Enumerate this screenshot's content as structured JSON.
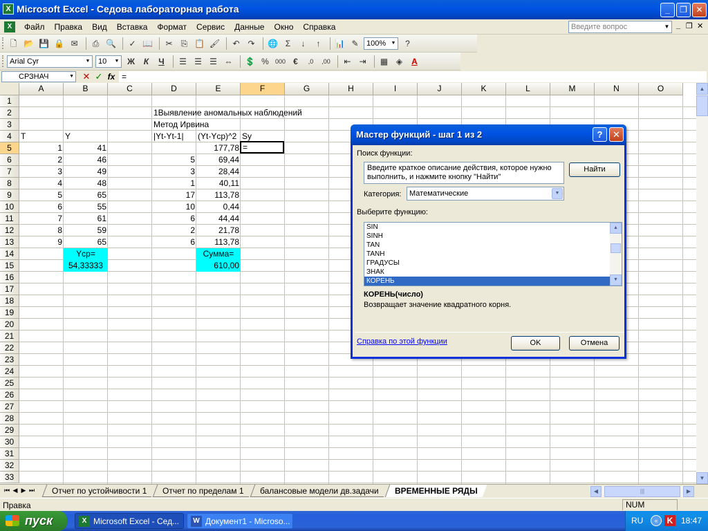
{
  "window": {
    "title": "Microsoft Excel - Седова лабораторная работа"
  },
  "menu": {
    "items": [
      "Файл",
      "Правка",
      "Вид",
      "Вставка",
      "Формат",
      "Сервис",
      "Данные",
      "Окно",
      "Справка"
    ],
    "ask_placeholder": "Введите вопрос"
  },
  "toolbar": {
    "zoom": "100%",
    "font": "Arial Cyr",
    "font_size": "10"
  },
  "formula_bar": {
    "name_box": "СРЗНАЧ",
    "formula": "="
  },
  "sheet": {
    "columns": [
      "A",
      "B",
      "C",
      "D",
      "E",
      "F",
      "G",
      "H",
      "I",
      "J",
      "K",
      "L",
      "M",
      "N",
      "O"
    ],
    "rows": [
      "1",
      "2",
      "3",
      "4",
      "5",
      "6",
      "7",
      "8",
      "9",
      "10",
      "11",
      "12",
      "13",
      "14",
      "15",
      "16",
      "17",
      "18",
      "19",
      "20",
      "21",
      "22",
      "23",
      "24",
      "25",
      "26",
      "27",
      "28",
      "29",
      "30",
      "31",
      "32",
      "33"
    ],
    "heading": "1Выявление аномальных наблюдений",
    "method": "Метод Ирвина",
    "headers": {
      "A": "T",
      "B": "Y",
      "D": "|Yt-Yt-1|",
      "E": "(Yt-Ycp)^2",
      "F": "Sy"
    },
    "data": [
      {
        "t": "1",
        "y": "41",
        "d": "",
        "e": "177,78"
      },
      {
        "t": "2",
        "y": "46",
        "d": "5",
        "e": "69,44"
      },
      {
        "t": "3",
        "y": "49",
        "d": "3",
        "e": "28,44"
      },
      {
        "t": "4",
        "y": "48",
        "d": "1",
        "e": "40,11"
      },
      {
        "t": "5",
        "y": "65",
        "d": "17",
        "e": "113,78"
      },
      {
        "t": "6",
        "y": "55",
        "d": "10",
        "e": "0,44"
      },
      {
        "t": "7",
        "y": "61",
        "d": "6",
        "e": "44,44"
      },
      {
        "t": "8",
        "y": "59",
        "d": "2",
        "e": "21,78"
      },
      {
        "t": "9",
        "y": "65",
        "d": "6",
        "e": "113,78"
      }
    ],
    "ycp_label": "Ycp=",
    "ycp_value": "54,33333",
    "sum_label": "Сумма=",
    "sum_value": "610,00",
    "active_cell_value": "="
  },
  "sheet_tabs": [
    "Отчет по устойчивости 1",
    "Отчет по пределам 1",
    "балансовые модели дв.задачи",
    "ВРЕМЕННЫЕ РЯДЫ"
  ],
  "status": {
    "mode": "Правка",
    "num": "NUM"
  },
  "taskbar": {
    "start": "пуск",
    "tasks": [
      "Microsoft Excel - Сед...",
      "Документ1 - Microso..."
    ],
    "lang": "RU",
    "time": "18:47"
  },
  "dialog": {
    "title": "Мастер функций - шаг 1 из 2",
    "search_label": "Поиск функции:",
    "search_text": "Введите краткое описание действия, которое нужно выполнить, и нажмите кнопку \"Найти\"",
    "find_button": "Найти",
    "category_label": "Категория:",
    "category_value": "Математические",
    "select_label": "Выберите функцию:",
    "functions": [
      "SIN",
      "SINH",
      "TAN",
      "TANH",
      "ГРАДУСЫ",
      "ЗНАК",
      "КОРЕНЬ"
    ],
    "selected_function": "КОРЕНЬ",
    "syntax": "КОРЕНЬ(число)",
    "description": "Возвращает значение квадратного корня.",
    "help_link": "Справка по этой функции",
    "ok": "OK",
    "cancel": "Отмена"
  }
}
